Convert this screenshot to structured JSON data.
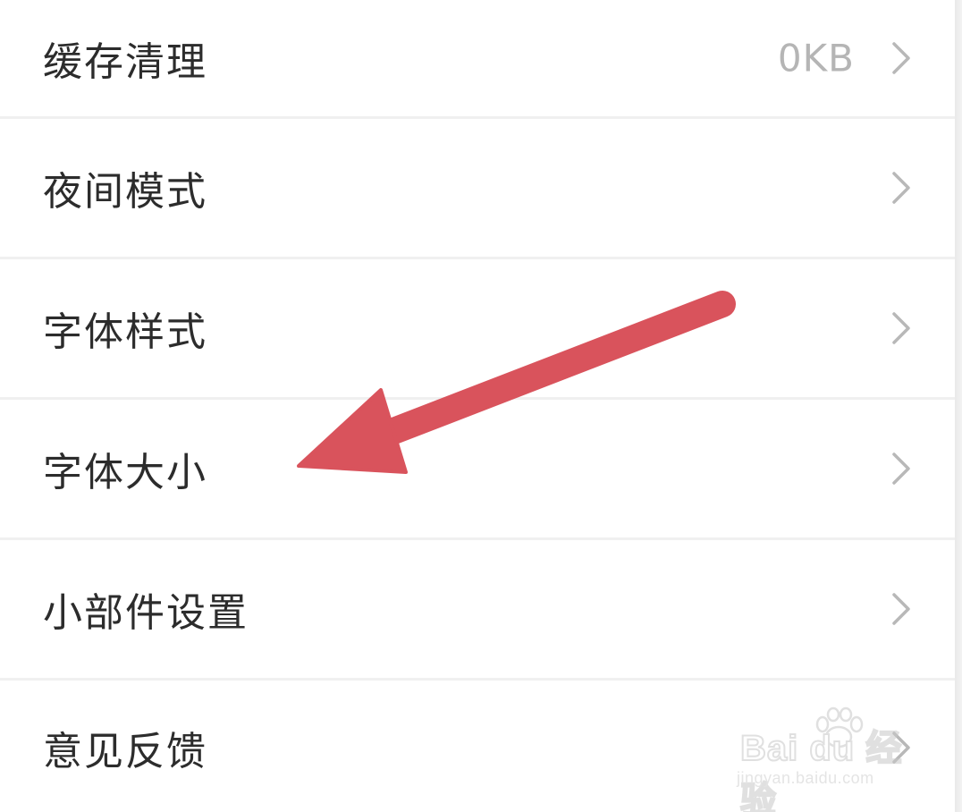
{
  "settings": {
    "items": [
      {
        "label": "缓存清理",
        "value": "0KB"
      },
      {
        "label": "夜间模式",
        "value": ""
      },
      {
        "label": "字体样式",
        "value": ""
      },
      {
        "label": "字体大小",
        "value": ""
      },
      {
        "label": "小部件设置",
        "value": ""
      },
      {
        "label": "意见反馈",
        "value": ""
      }
    ]
  },
  "annotation": {
    "arrow_color": "#d9535c",
    "points_to": "字体大小"
  },
  "watermark": {
    "brand": "Bai du 经验",
    "url": "jingyan.baidu.com"
  },
  "colors": {
    "label": "#2c2c2c",
    "value": "#b5b5b5",
    "chevron": "#b8b8b8",
    "divider": "#f0f0f0"
  }
}
